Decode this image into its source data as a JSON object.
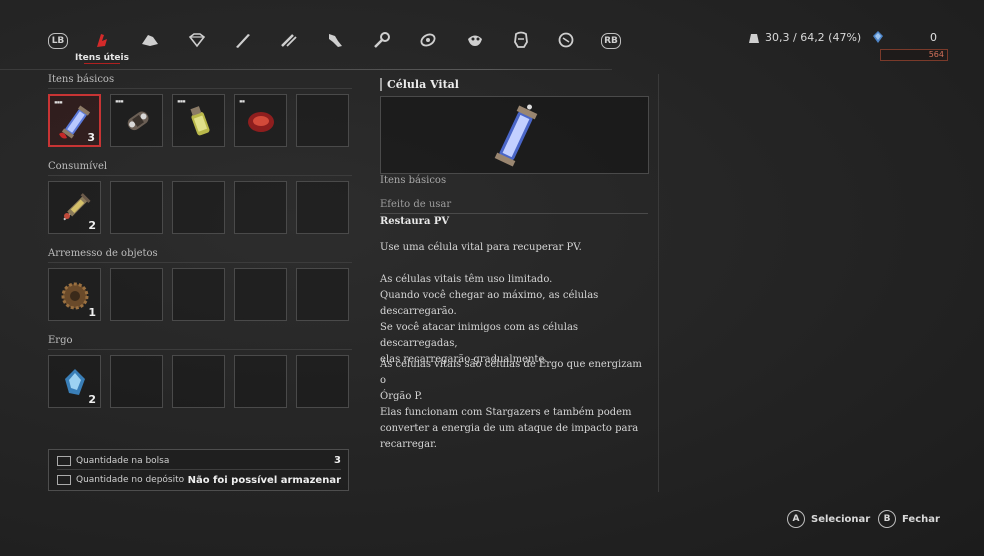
{
  "topbar": {
    "left_bumper": "LB",
    "right_bumper": "RB",
    "active_tab_label": "Itens úteis",
    "tabs": [
      {
        "icon": "useful-items-icon"
      },
      {
        "icon": "materials-icon"
      },
      {
        "icon": "gem-icon"
      },
      {
        "icon": "weapon-icon"
      },
      {
        "icon": "handle-icon"
      },
      {
        "icon": "legion-arm-icon"
      },
      {
        "icon": "wrench-icon"
      },
      {
        "icon": "amulet-icon"
      },
      {
        "icon": "mask-icon"
      },
      {
        "icon": "costume-icon"
      },
      {
        "icon": "key-icon"
      }
    ],
    "weight": "30,3 / 64,2 (47%)",
    "ergo_amount": "0",
    "ergo_sub_amount": "564"
  },
  "sections": [
    {
      "label": "Itens básicos",
      "slots": [
        {
          "item": "pulse-cell",
          "count": "3",
          "pips": "▪▪▪",
          "selected": true
        },
        {
          "item": "throwing-cell",
          "count": "",
          "pips": "▪▪▪"
        },
        {
          "item": "yellow-bottle",
          "count": "",
          "pips": "▪▪▪"
        },
        {
          "item": "red-stone",
          "count": "",
          "pips": "▪▪"
        },
        {
          "item": "",
          "count": ""
        }
      ]
    },
    {
      "label": "Consumível",
      "slots": [
        {
          "item": "syringe",
          "count": "2"
        },
        {
          "item": "",
          "count": ""
        },
        {
          "item": "",
          "count": ""
        },
        {
          "item": "",
          "count": ""
        },
        {
          "item": "",
          "count": ""
        }
      ]
    },
    {
      "label": "Arremesso de objetos",
      "slots": [
        {
          "item": "gear-grenade",
          "count": "1"
        },
        {
          "item": "",
          "count": ""
        },
        {
          "item": "",
          "count": ""
        },
        {
          "item": "",
          "count": ""
        },
        {
          "item": "",
          "count": ""
        }
      ]
    },
    {
      "label": "Ergo",
      "slots": [
        {
          "item": "ergo-crystal",
          "count": "2"
        },
        {
          "item": "",
          "count": ""
        },
        {
          "item": "",
          "count": ""
        },
        {
          "item": "",
          "count": ""
        },
        {
          "item": "",
          "count": ""
        }
      ]
    }
  ],
  "bag": {
    "bag_label": "Quantidade na bolsa",
    "bag_value": "3",
    "storage_label": "Quantidade no depósito",
    "storage_value": "Não foi possível armazenar"
  },
  "detail": {
    "title": "Célula Vital",
    "category": "Itens básicos",
    "effect_label": "Efeito de usar",
    "effect_name": "Restaura PV",
    "desc1": "Use uma célula vital para recuperar PV.",
    "desc2_lines": [
      "As células vitais têm uso limitado.",
      "Quando você chegar ao máximo, as células",
      "descarregarão.",
      "Se você atacar inimigos com as células descarregadas,",
      "elas recarregarão gradualmente."
    ],
    "desc3_lines": [
      "As células vitais são células de Ergo que energizam o",
      "Órgão P.",
      "Elas funcionam com Stargazers e também podem",
      "converter a energia de um ataque de impacto para",
      "recarregar."
    ]
  },
  "footer": {
    "select_key": "A",
    "select_label": "Selecionar",
    "close_key": "B",
    "close_label": "Fechar"
  }
}
